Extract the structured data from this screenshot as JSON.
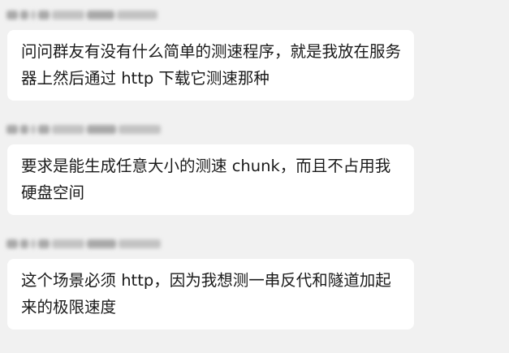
{
  "chat": {
    "messages": [
      {
        "sender_name": "",
        "text": "问问群友有没有什么简单的测速程序，就是我放在服务器上然后通过 http 下载它测速那种"
      },
      {
        "sender_name": "",
        "text": "要求是能生成任意大小的测速 chunk，而且不占用我硬盘空间"
      },
      {
        "sender_name": "",
        "text": "这个场景必须 http，因为我想测一串反代和隧道加起来的极限速度"
      }
    ]
  },
  "colors": {
    "background": "#f1f1f1",
    "bubble": "#ffffff",
    "text": "#1a1a1a",
    "sender_blur": "#a9a9a9"
  }
}
